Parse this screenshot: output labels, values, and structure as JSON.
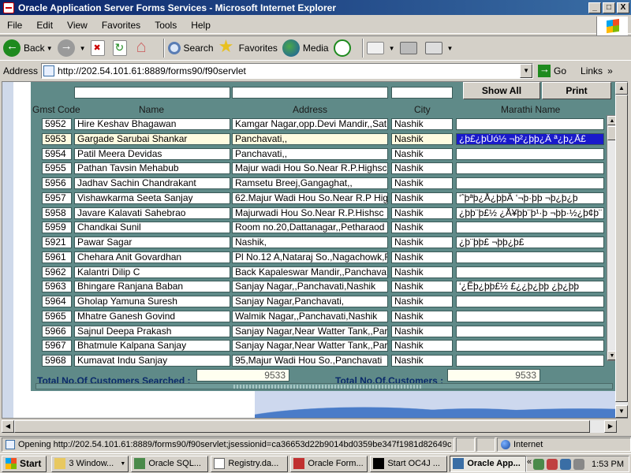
{
  "window": {
    "title": "Oracle Application Server Forms Services - Microsoft Internet Explorer",
    "buttons": [
      "_",
      "□",
      "X"
    ]
  },
  "menu": [
    "File",
    "Edit",
    "View",
    "Favorites",
    "Tools",
    "Help"
  ],
  "toolbar": {
    "back": "Back",
    "search": "Search",
    "favorites": "Favorites",
    "media": "Media"
  },
  "address": {
    "label": "Address",
    "url": "http://202.54.101.61:8889/forms90/f90servlet",
    "go": "Go",
    "links": "Links"
  },
  "form": {
    "show_all": "Show All",
    "print": "Print",
    "columns": [
      "Gmst Code",
      "Name",
      "Address",
      "City",
      "Marathi Name"
    ],
    "rows": [
      {
        "code": "5952",
        "name": "Hire Keshav Bhagawan",
        "address": "Kamgar Nagar,opp.Devi Mandir,,Sat",
        "city": "Nashik",
        "marathi": ""
      },
      {
        "code": "5953",
        "name": "Gargade Sarubai Shankar",
        "address": "Panchavati,,",
        "city": "Nashik",
        "marathi": "¿þ£¿þÚó½ ¬þ²¿þþ¿Ä  ª¿þ¿Å£"
      },
      {
        "code": "5954",
        "name": "Patil Meera Devidas",
        "address": "Panchavati,,",
        "city": "Nashik",
        "marathi": ""
      },
      {
        "code": "5955",
        "name": "Pathan Tavsin Mehabub",
        "address": "Majur wadi Hou So.Near R.P.Highsc",
        "city": "Nashik",
        "marathi": ""
      },
      {
        "code": "5956",
        "name": "Jadhav Sachin Chandrakant",
        "address": "Ramsetu Breej,Gangaghat,,",
        "city": "Nashik",
        "marathi": ""
      },
      {
        "code": "5957",
        "name": "Vishawkarma Seeta Sanjay",
        "address": "62.Majur Wadi Hou So.Near R.P Hig",
        "city": "Nashik",
        "marathi": "‘ˆþªþ¿Å¿þþÄ ‘¬þ·þþ ¬þ¿þ¿þ"
      },
      {
        "code": "5958",
        "name": "Javare Kalavati Sahebrao",
        "address": "Majurwadi Hou So.Near R.P.Hishsc",
        "city": "Nashik",
        "marathi": "¿þþ¨þ£½ ¿Å¥þþ¨þ¹·þ ¬þþ·½¿þ¢þ¨"
      },
      {
        "code": "5959",
        "name": "Chandkai Sunil",
        "address": "Room no.20,Dattanagar,,Petharaod",
        "city": "Nashik",
        "marathi": ""
      },
      {
        "code": "5921",
        "name": "Pawar Sagar",
        "address": "Nashik,",
        "city": "Nashik",
        "marathi": "¿þ¨þþ£ ¬þþ¿þ£"
      },
      {
        "code": "5961",
        "name": "Chehara Anit Govardhan",
        "address": "Pl No.12 A,Nataraj So.,Nagachowk,F",
        "city": "Nashik",
        "marathi": ""
      },
      {
        "code": "5962",
        "name": "Kalantri Dilip C",
        "address": "Back Kapaleswar Mandir,,Panchava",
        "city": "Nashik",
        "marathi": ""
      },
      {
        "code": "5963",
        "name": "Bhingare Ranjana Baban",
        "address": "Sanjay Nagar,,Panchavati,Nashik",
        "city": "Nashik",
        "marathi": "‘¿Êþ¿þþ£½ £¿¿þ¿þþ ¿þ¿þþ"
      },
      {
        "code": "5964",
        "name": "Gholap Yamuna Suresh",
        "address": "Sanjay Nagar,Panchavati,",
        "city": "Nashik",
        "marathi": ""
      },
      {
        "code": "5965",
        "name": "Mhatre Ganesh Govind",
        "address": "Walmik Nagar,,Panchavati,Nashik",
        "city": "Nashik",
        "marathi": ""
      },
      {
        "code": "5966",
        "name": "Sajnul Deepa Prakash",
        "address": "Sanjay Nagar,Near Watter Tank,,Par",
        "city": "Nashik",
        "marathi": ""
      },
      {
        "code": "5967",
        "name": "Bhatmule Kalpana Sanjay",
        "address": "Sanjay Nagar,Near Watter Tank,,Par",
        "city": "Nashik",
        "marathi": ""
      },
      {
        "code": "5968",
        "name": "Kumavat Indu Sanjay",
        "address": "95,Majur Wadi Hou So.,Panchavati",
        "city": "Nashik",
        "marathi": ""
      }
    ],
    "total_searched_label": "Total No.Of Customers Searched :",
    "total_searched_value": "9533",
    "total_customers_label": "Total No.Of.Customers :",
    "total_customers_value": "9533"
  },
  "status": {
    "text": "Opening http://202.54.101.61:8889/forms90/f90servlet;jsessionid=ca36653d22b9014bd0359be347f1981d82649c",
    "zone": "Internet"
  },
  "taskbar": {
    "start": "Start",
    "tasks": [
      "3 Window...",
      "Oracle SQL...",
      "Registry.da...",
      "Oracle Form...",
      "Start OC4J ...",
      "Oracle App..."
    ],
    "toggle": "«",
    "time": "1:53 PM"
  },
  "colors": {
    "form_bg": "#5f8a88",
    "selection": "#1a1acb",
    "titlebar": "#0a246a"
  }
}
